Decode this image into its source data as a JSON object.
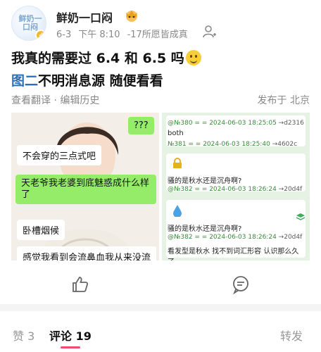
{
  "post": {
    "username": "鲜奶一口闷",
    "avatar_text": "鲜奶一口闷",
    "date": "6-3",
    "time": "下午 8:10",
    "source": "-17所愿皆成真",
    "title": "我真的需要过 6.4 和 6.5 吗",
    "subtitle_link": "图二",
    "subtitle_rest": "不明消息源 随便看看",
    "translate": "查看翻译",
    "edit_history": "· 编辑历史",
    "location": "发布于 北京"
  },
  "left_image": {
    "bubbles": [
      "???",
      "不会穿的三点式吧",
      "天老爷我老婆到底魅惑成什么样了",
      "卧槽烟候",
      "感觉我看到会流鼻血我从来没流"
    ]
  },
  "right_image": {
    "rows": [
      {
        "id": "@№380 = = 2024-06-03 18:25:05",
        "tail": "→d2316",
        "msg": "both"
      },
      {
        "id": "№381 = = 2024-06-03 18:25:40",
        "tail": "→4602c",
        "msg": ""
      },
      {
        "id": "",
        "tail": "",
        "msg": "骚的是秋水还是沉舟啊?"
      },
      {
        "id": "@№382 = = 2024-06-03 18:26:24",
        "tail": "→20d4f",
        "msg": ""
      },
      {
        "id": "",
        "tail": "",
        "msg": "骚的是秋水还是沉舟啊?"
      },
      {
        "id": "@№382 = = 2024-06-03 18:26:24",
        "tail": "→20d4f",
        "msg": ""
      },
      {
        "id": "",
        "tail": "",
        "msg": "看发型是秋水  找不到词汇形容 认识那么久了"
      }
    ]
  },
  "tabs": {
    "likes": "赞 3",
    "comments": "评论 19",
    "repost": "转发"
  }
}
